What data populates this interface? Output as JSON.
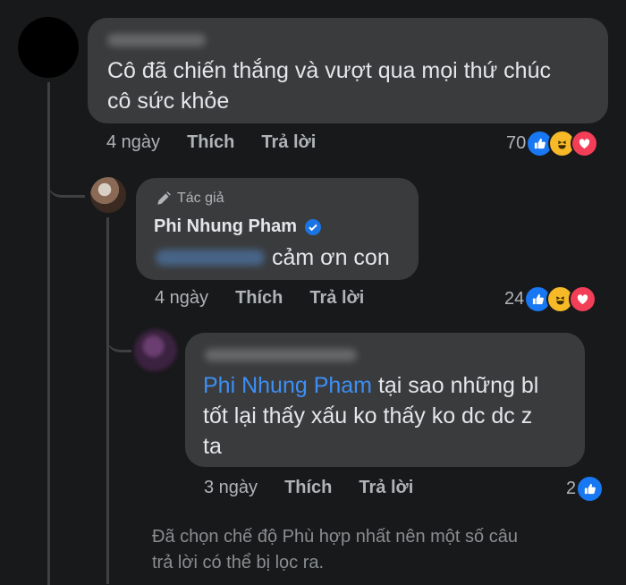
{
  "comments": [
    {
      "text": "Cô đã chiến thắng và vượt qua mọi thứ chúc cô sức khỏe",
      "line1": "Cô đã chiến thắng và vượt qua mọi thứ chúc",
      "line2": "cô sức khỏe",
      "time": "4 ngày",
      "like_label": "Thích",
      "reply_label": "Trả lời",
      "reaction_count": "70",
      "reactions": [
        "like-icon",
        "haha-icon",
        "love-icon"
      ]
    },
    {
      "badge": "Tác giả",
      "author": "Phi Nhung Pham",
      "verified": true,
      "text": "cảm ơn con",
      "time": "4 ngày",
      "like_label": "Thích",
      "reply_label": "Trả lời",
      "reaction_count": "24",
      "reactions": [
        "like-icon",
        "haha-icon",
        "love-icon"
      ]
    },
    {
      "mention": "Phi Nhung Pham",
      "line1": " tại sao những bl",
      "line2": "tốt lại thấy xấu ko thấy ko dc dc z",
      "line3": "ta",
      "time": "3 ngày",
      "like_label": "Thích",
      "reply_label": "Trả lời",
      "reaction_count": "2",
      "reactions": [
        "like-icon"
      ]
    }
  ],
  "filter_note_line1": "Đã chọn chế độ Phù hợp nhất nên một số câu",
  "filter_note_line2": "trả lời có thể bị lọc ra.",
  "colors": {
    "background": "#18191a",
    "bubble": "#3a3b3c",
    "link": "#3d8ff5",
    "like": "#1877f2",
    "haha": "#f7b928",
    "love": "#f33e58",
    "verified": "#1b74e4"
  }
}
